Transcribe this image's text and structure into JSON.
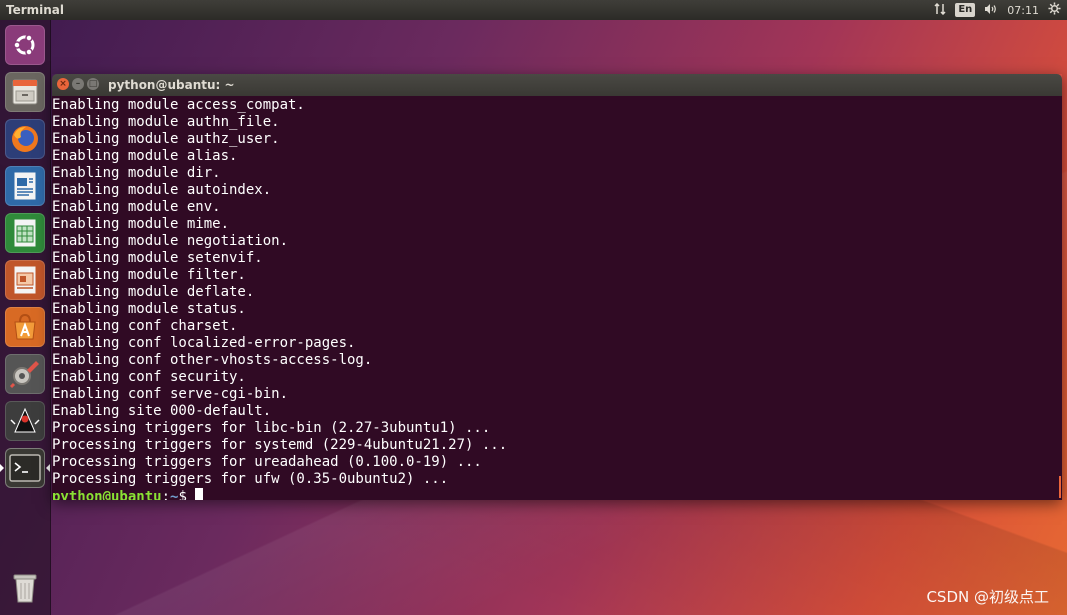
{
  "topbar": {
    "app_name": "Terminal",
    "keyboard_layout": "En",
    "time": "07:11",
    "icons": [
      "network-icon",
      "keyboard-layout-indicator",
      "volume-icon",
      "settings-gear-icon"
    ]
  },
  "launcher": {
    "items": [
      {
        "name": "dash",
        "icon": "ubuntu-logo-icon"
      },
      {
        "name": "files",
        "icon": "files-cabinet-icon"
      },
      {
        "name": "firefox",
        "icon": "firefox-icon"
      },
      {
        "name": "writer",
        "icon": "libreoffice-writer-icon"
      },
      {
        "name": "calc",
        "icon": "libreoffice-calc-icon"
      },
      {
        "name": "impress",
        "icon": "libreoffice-impress-icon"
      },
      {
        "name": "software",
        "icon": "software-center-icon"
      },
      {
        "name": "system-settings",
        "icon": "system-settings-icon"
      },
      {
        "name": "java-app",
        "icon": "java-duke-icon"
      },
      {
        "name": "terminal",
        "icon": "terminal-icon",
        "active": true
      },
      {
        "name": "trash",
        "icon": "trash-icon"
      }
    ]
  },
  "window": {
    "title": "python@ubantu: ~",
    "buttons": {
      "close": "×",
      "minimize": "–",
      "maximize": "□"
    }
  },
  "terminal": {
    "lines": [
      "Enabling module access_compat.",
      "Enabling module authn_file.",
      "Enabling module authz_user.",
      "Enabling module alias.",
      "Enabling module dir.",
      "Enabling module autoindex.",
      "Enabling module env.",
      "Enabling module mime.",
      "Enabling module negotiation.",
      "Enabling module setenvif.",
      "Enabling module filter.",
      "Enabling module deflate.",
      "Enabling module status.",
      "Enabling conf charset.",
      "Enabling conf localized-error-pages.",
      "Enabling conf other-vhosts-access-log.",
      "Enabling conf security.",
      "Enabling conf serve-cgi-bin.",
      "Enabling site 000-default.",
      "Processing triggers for libc-bin (2.27-3ubuntu1) ...",
      "Processing triggers for systemd (229-4ubuntu21.27) ...",
      "Processing triggers for ureadahead (0.100.0-19) ...",
      "Processing triggers for ufw (0.35-0ubuntu2) ..."
    ],
    "prompt": {
      "user_host": "python@ubantu",
      "separator": ":",
      "path": "~",
      "symbol": "$"
    }
  },
  "watermark": "CSDN @初级点工",
  "colors": {
    "terminal_bg": "#300a24",
    "prompt_user": "#8ae234",
    "prompt_path": "#729fcf",
    "accent": "#e9653b"
  }
}
